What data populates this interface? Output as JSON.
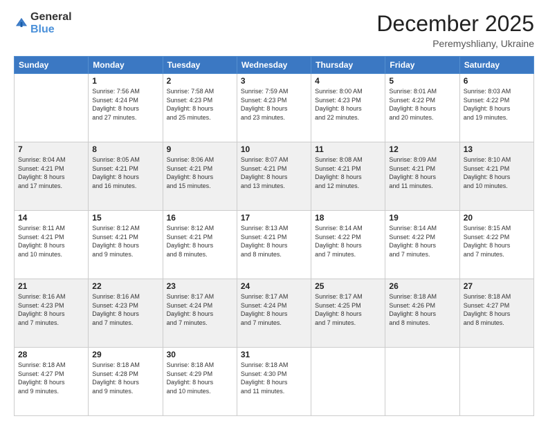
{
  "header": {
    "logo_general": "General",
    "logo_blue": "Blue",
    "month": "December 2025",
    "location": "Peremyshliany, Ukraine"
  },
  "days_of_week": [
    "Sunday",
    "Monday",
    "Tuesday",
    "Wednesday",
    "Thursday",
    "Friday",
    "Saturday"
  ],
  "weeks": [
    [
      {
        "day": "",
        "info": ""
      },
      {
        "day": "1",
        "info": "Sunrise: 7:56 AM\nSunset: 4:24 PM\nDaylight: 8 hours\nand 27 minutes."
      },
      {
        "day": "2",
        "info": "Sunrise: 7:58 AM\nSunset: 4:23 PM\nDaylight: 8 hours\nand 25 minutes."
      },
      {
        "day": "3",
        "info": "Sunrise: 7:59 AM\nSunset: 4:23 PM\nDaylight: 8 hours\nand 23 minutes."
      },
      {
        "day": "4",
        "info": "Sunrise: 8:00 AM\nSunset: 4:23 PM\nDaylight: 8 hours\nand 22 minutes."
      },
      {
        "day": "5",
        "info": "Sunrise: 8:01 AM\nSunset: 4:22 PM\nDaylight: 8 hours\nand 20 minutes."
      },
      {
        "day": "6",
        "info": "Sunrise: 8:03 AM\nSunset: 4:22 PM\nDaylight: 8 hours\nand 19 minutes."
      }
    ],
    [
      {
        "day": "7",
        "info": "Sunrise: 8:04 AM\nSunset: 4:21 PM\nDaylight: 8 hours\nand 17 minutes."
      },
      {
        "day": "8",
        "info": "Sunrise: 8:05 AM\nSunset: 4:21 PM\nDaylight: 8 hours\nand 16 minutes."
      },
      {
        "day": "9",
        "info": "Sunrise: 8:06 AM\nSunset: 4:21 PM\nDaylight: 8 hours\nand 15 minutes."
      },
      {
        "day": "10",
        "info": "Sunrise: 8:07 AM\nSunset: 4:21 PM\nDaylight: 8 hours\nand 13 minutes."
      },
      {
        "day": "11",
        "info": "Sunrise: 8:08 AM\nSunset: 4:21 PM\nDaylight: 8 hours\nand 12 minutes."
      },
      {
        "day": "12",
        "info": "Sunrise: 8:09 AM\nSunset: 4:21 PM\nDaylight: 8 hours\nand 11 minutes."
      },
      {
        "day": "13",
        "info": "Sunrise: 8:10 AM\nSunset: 4:21 PM\nDaylight: 8 hours\nand 10 minutes."
      }
    ],
    [
      {
        "day": "14",
        "info": "Sunrise: 8:11 AM\nSunset: 4:21 PM\nDaylight: 8 hours\nand 10 minutes."
      },
      {
        "day": "15",
        "info": "Sunrise: 8:12 AM\nSunset: 4:21 PM\nDaylight: 8 hours\nand 9 minutes."
      },
      {
        "day": "16",
        "info": "Sunrise: 8:12 AM\nSunset: 4:21 PM\nDaylight: 8 hours\nand 8 minutes."
      },
      {
        "day": "17",
        "info": "Sunrise: 8:13 AM\nSunset: 4:21 PM\nDaylight: 8 hours\nand 8 minutes."
      },
      {
        "day": "18",
        "info": "Sunrise: 8:14 AM\nSunset: 4:22 PM\nDaylight: 8 hours\nand 7 minutes."
      },
      {
        "day": "19",
        "info": "Sunrise: 8:14 AM\nSunset: 4:22 PM\nDaylight: 8 hours\nand 7 minutes."
      },
      {
        "day": "20",
        "info": "Sunrise: 8:15 AM\nSunset: 4:22 PM\nDaylight: 8 hours\nand 7 minutes."
      }
    ],
    [
      {
        "day": "21",
        "info": "Sunrise: 8:16 AM\nSunset: 4:23 PM\nDaylight: 8 hours\nand 7 minutes."
      },
      {
        "day": "22",
        "info": "Sunrise: 8:16 AM\nSunset: 4:23 PM\nDaylight: 8 hours\nand 7 minutes."
      },
      {
        "day": "23",
        "info": "Sunrise: 8:17 AM\nSunset: 4:24 PM\nDaylight: 8 hours\nand 7 minutes."
      },
      {
        "day": "24",
        "info": "Sunrise: 8:17 AM\nSunset: 4:24 PM\nDaylight: 8 hours\nand 7 minutes."
      },
      {
        "day": "25",
        "info": "Sunrise: 8:17 AM\nSunset: 4:25 PM\nDaylight: 8 hours\nand 7 minutes."
      },
      {
        "day": "26",
        "info": "Sunrise: 8:18 AM\nSunset: 4:26 PM\nDaylight: 8 hours\nand 8 minutes."
      },
      {
        "day": "27",
        "info": "Sunrise: 8:18 AM\nSunset: 4:27 PM\nDaylight: 8 hours\nand 8 minutes."
      }
    ],
    [
      {
        "day": "28",
        "info": "Sunrise: 8:18 AM\nSunset: 4:27 PM\nDaylight: 8 hours\nand 9 minutes."
      },
      {
        "day": "29",
        "info": "Sunrise: 8:18 AM\nSunset: 4:28 PM\nDaylight: 8 hours\nand 9 minutes."
      },
      {
        "day": "30",
        "info": "Sunrise: 8:18 AM\nSunset: 4:29 PM\nDaylight: 8 hours\nand 10 minutes."
      },
      {
        "day": "31",
        "info": "Sunrise: 8:18 AM\nSunset: 4:30 PM\nDaylight: 8 hours\nand 11 minutes."
      },
      {
        "day": "",
        "info": ""
      },
      {
        "day": "",
        "info": ""
      },
      {
        "day": "",
        "info": ""
      }
    ]
  ]
}
